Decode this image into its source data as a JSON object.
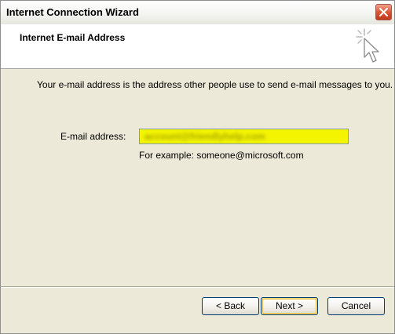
{
  "window": {
    "title": "Internet Connection Wizard"
  },
  "header": {
    "title": "Internet E-mail Address"
  },
  "content": {
    "intro": "Your e-mail address is the address other people use to send e-mail messages to you.",
    "email_label": "E-mail address:",
    "email_value": "account@friendlyhelp.com",
    "example": "For example: someone@microsoft.com"
  },
  "buttons": {
    "back": "< Back",
    "next": "Next >",
    "cancel": "Cancel"
  },
  "colors": {
    "highlight": "#f4f400",
    "titlebar": "#f3f3f0",
    "close": "#d9502e"
  },
  "icons": {
    "close": "close-icon",
    "wizard": "wizard-cursor-icon"
  }
}
